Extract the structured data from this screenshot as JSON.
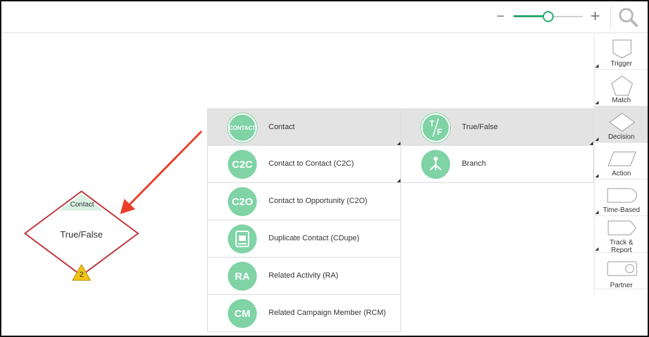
{
  "toolbar": {
    "zoom_out_label": "−",
    "zoom_in_label": "+",
    "zoom_level": 0.5,
    "search_icon": "search-icon"
  },
  "palette": {
    "items": [
      {
        "label": "Trigger",
        "icon": "trigger-shape-icon"
      },
      {
        "label": "Match",
        "icon": "pentagon-icon"
      },
      {
        "label": "Decision",
        "icon": "diamond-icon",
        "active": true
      },
      {
        "label": "Action",
        "icon": "parallelogram-icon"
      },
      {
        "label": "Time-Based",
        "icon": "delay-shape-icon"
      },
      {
        "label": "Track &",
        "label2": "Report",
        "icon": "arrow-tag-icon"
      },
      {
        "label": "Partner",
        "icon": "toggle-shape-icon"
      }
    ]
  },
  "menu": {
    "items": [
      {
        "badge": "CONTACT",
        "label": "Contact",
        "selected": true
      },
      {
        "badge": "C2C",
        "label": "Contact to Contact (C2C)"
      },
      {
        "badge": "C2O",
        "label": "Contact to Opportunity (C2O)"
      },
      {
        "badge": "",
        "label": "Duplicate Contact (CDupe)",
        "icon": "duplicate-contact-icon"
      },
      {
        "badge": "RA",
        "label": "Related Activity (RA)"
      },
      {
        "badge": "CM",
        "label": "Related Campaign Member (RCM)"
      }
    ]
  },
  "submenu": {
    "items": [
      {
        "label": "True/False",
        "icon": "true-false-icon",
        "selected": true
      },
      {
        "label": "Branch",
        "icon": "branch-icon"
      }
    ]
  },
  "node": {
    "header": "Contact",
    "title": "True/False",
    "warning_count": "2"
  },
  "colors": {
    "accent_green": "#2aa86a",
    "icon_green": "#7fd3a5",
    "node_border": "#c0323a",
    "arrow_red": "#e8402c",
    "warning_yellow": "#f2c318"
  }
}
